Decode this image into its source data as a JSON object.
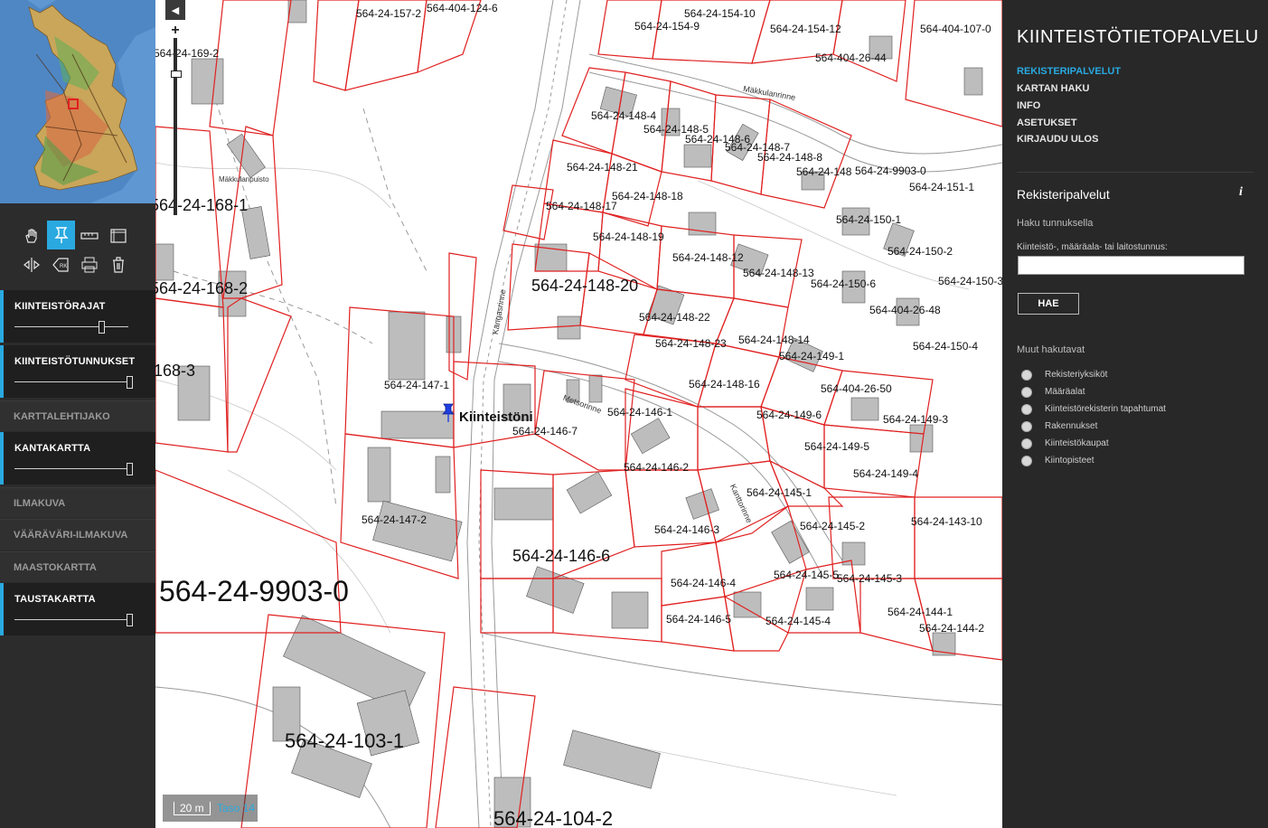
{
  "sidebar_left": {
    "tools": [
      {
        "name": "pan-tool",
        "icon": "hand-icon",
        "glyph": "✋"
      },
      {
        "name": "property-pin-tool",
        "icon": "pin-icon",
        "glyph": "⚲"
      },
      {
        "name": "measure-line-tool",
        "icon": "ruler-icon",
        "glyph": "▭"
      },
      {
        "name": "measure-area-tool",
        "icon": "area-icon",
        "glyph": "▦"
      },
      {
        "name": "split-tool",
        "icon": "split-icon",
        "glyph": "⇹"
      },
      {
        "name": "label-tool",
        "icon": "tag-icon",
        "glyph": "⎈"
      },
      {
        "name": "print-tool",
        "icon": "print-icon",
        "glyph": "⎙"
      },
      {
        "name": "clear-tool",
        "icon": "trash-icon",
        "glyph": "🗑"
      }
    ],
    "layers_active": [
      {
        "label": "KIINTEISTÖRAJAT",
        "opacity": 0.75
      },
      {
        "label": "KIINTEISTÖTUNNUKSET",
        "opacity": 1.0
      },
      {
        "label": "KANTAKARTTA",
        "opacity": 1.0
      },
      {
        "label": "TAUSTAKARTTA",
        "opacity": 1.0
      }
    ],
    "layers_inactive": [
      "KARTTALEHTIJAKO",
      "ILMAKUVA",
      "VÄÄRÄVÄRI-ILMAKUVA",
      "MAASTOKARTTA"
    ]
  },
  "map": {
    "scale": "20 m",
    "level": "Taso 14",
    "marker_label": "Kiinteistöni",
    "parcels": {
      "p1": "564-24-157-2",
      "p2": "564-404-124-6",
      "p3": "564-24-154-10",
      "p4": "564-24-154-9",
      "p5": "564-24-154-12",
      "p6": "564-404-107-0",
      "p7": "564-404-26-44",
      "p8": "564-24-148-4",
      "p9": "564-24-148-5",
      "p10": "564-24-148-6",
      "p11": "564-24-148-7",
      "p12": "564-24-148-8",
      "p13": "564-24-148-21",
      "p14": "564-24-148",
      "p15": "564-24-9903-0",
      "p16": "564-24-151-1",
      "p17": "564-24-148-18",
      "p18": "564-24-148-17",
      "p19": "564-24-150-1",
      "p20": "564-24-148-19",
      "p21": "564-24-150-2",
      "p22": "564-24-148-12",
      "p23": "564-24-148-13",
      "p24": "564-24-150-6",
      "p25": "564-24-150-3",
      "p26": "564-24-148-20",
      "p27": "564-404-26-48",
      "p28": "564-24-148-22",
      "p29": "564-24-148-14",
      "p30": "564-24-148-23",
      "p31": "564-24-150-4",
      "p32": "564-24-149-1",
      "p33": "564-24-147-1",
      "p34": "564-24-148-16",
      "p35": "564-404-26-50",
      "p36": "564-24-146-1",
      "p37": "564-24-149-6",
      "p38": "564-24-149-3",
      "p39": "564-24-146-7",
      "p40": "564-24-149-5",
      "p41": "564-24-146-2",
      "p42": "564-24-149-4",
      "p43": "564-24-145-1",
      "p44": "564-24-147-2",
      "p45": "564-24-146-3",
      "p46": "564-24-145-2",
      "p47": "564-24-143-10",
      "p48": "564-24-146-6",
      "p49": "564-24-145-5",
      "p50": "564-24-145-3",
      "p51": "564-24-146-4",
      "p52": "564-24-144-1",
      "p53": "564-24-146-5",
      "p54": "564-24-145-4",
      "p55": "564-24-144-2",
      "p56": "564-24-103-1",
      "p57": "564-24-104-2",
      "p58": "564-24-168-1",
      "p59": "564-24-168-2",
      "p60": "564-24-169-2",
      "p61": "168-3",
      "p62": "564-24-9903-0"
    },
    "streets": [
      "Mäkkulanrinne",
      "Mäkkulanpuisto",
      "Kangasrinne",
      "Metsorinne",
      "Kanttorinne"
    ]
  },
  "sidebar_right": {
    "title": "KIINTEISTÖTIETOPALVELU",
    "nav": [
      {
        "label": "REKISTERIPALVELUT",
        "active": true
      },
      {
        "label": "KARTAN HAKU",
        "active": false
      },
      {
        "label": "INFO",
        "active": false
      },
      {
        "label": "ASETUKSET",
        "active": false
      },
      {
        "label": "KIRJAUDU ULOS",
        "active": false
      }
    ],
    "section_title": "Rekisteripalvelut",
    "info_icon": "i",
    "search_heading": "Haku tunnuksella",
    "search_label": "Kiinteistö-, määräala- tai laitostunnus:",
    "search_value": "",
    "search_button": "HAE",
    "other_heading": "Muut hakutavat",
    "other_options": [
      "Rekisteriyksiköt",
      "Määräalat",
      "Kiinteistörekisterin tapahtumat",
      "Rakennukset",
      "Kiinteistökaupat",
      "Kiintopisteet"
    ]
  }
}
